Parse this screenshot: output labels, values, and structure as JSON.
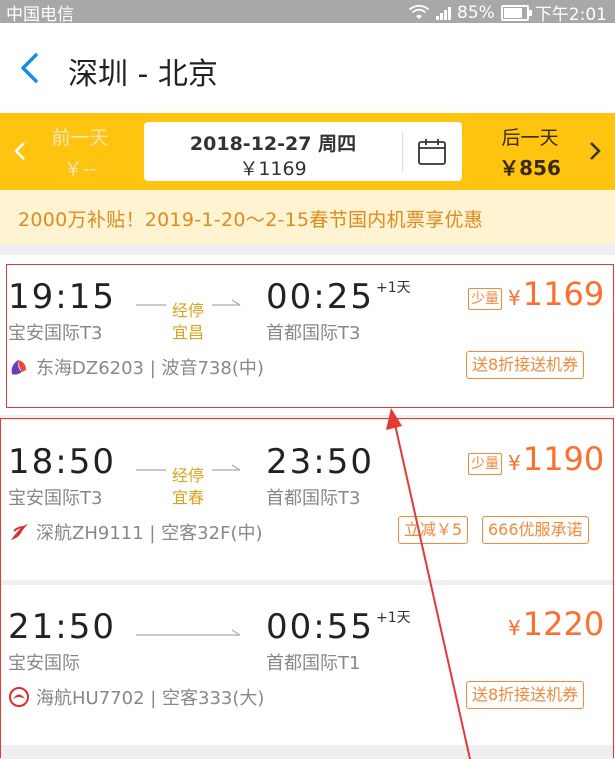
{
  "status_bar": {
    "carrier": "中国电信",
    "battery": "85%",
    "time": "下午2:01"
  },
  "header": {
    "title": "深圳 - 北京"
  },
  "date_bar": {
    "prev": {
      "label": "前一天",
      "price": "￥--"
    },
    "current": {
      "date": "2018-12-27  周四",
      "price": "￥1169"
    },
    "next": {
      "label": "后一天",
      "price": "￥856"
    }
  },
  "promo": {
    "text": "2000万补贴！2019-1-20～2-15春节国内机票享优惠"
  },
  "flights": [
    {
      "dep_time": "19:15",
      "dep_airport": "宝安国际T3",
      "arr_time": "00:25",
      "arr_airport": "首都国际T3",
      "plus_day": "+1天",
      "stop_label": "经停",
      "stop_city": "宜昌",
      "few_tag": "少量",
      "currency": "¥",
      "price": "1169",
      "airline": "东海DZ6203  |  波音738(中)",
      "badges": [
        "送8折接送机券"
      ]
    },
    {
      "dep_time": "18:50",
      "dep_airport": "宝安国际T3",
      "arr_time": "23:50",
      "arr_airport": "首都国际T3",
      "plus_day": "",
      "stop_label": "经停",
      "stop_city": "宜春",
      "few_tag": "少量",
      "currency": "¥",
      "price": "1190",
      "airline": "深航ZH9111  |  空客32F(中)",
      "badges": [
        "立减￥5",
        "666优服承诺"
      ]
    },
    {
      "dep_time": "21:50",
      "dep_airport": "宝安国际",
      "arr_time": "00:55",
      "arr_airport": "首都国际T1",
      "plus_day": "+1天",
      "stop_label": "",
      "stop_city": "",
      "few_tag": "",
      "currency": "¥",
      "price": "1220",
      "airline": "海航HU7702  |  空客333(大)",
      "badges": [
        "送8折接送机券"
      ]
    }
  ],
  "colors": {
    "accent_yellow": "#ffc410",
    "price_orange": "#ff6f2b",
    "back_blue": "#1e88e5",
    "annotation_red": "#e53935"
  }
}
